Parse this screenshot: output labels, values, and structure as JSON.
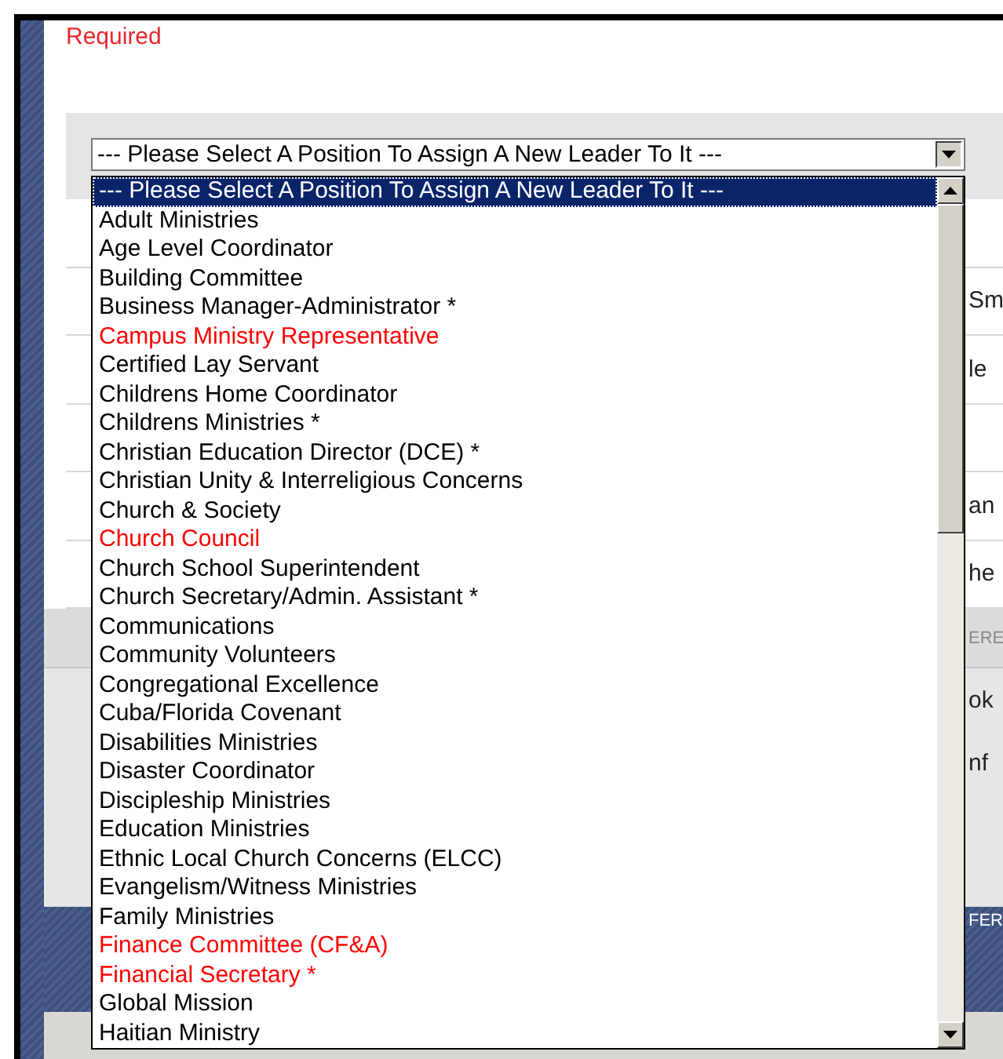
{
  "required_label": "Required",
  "background_table": {
    "rows": [
      {},
      {
        "column_2": "Sm"
      },
      {
        "column_2": "le"
      },
      {},
      {
        "column_2": "an"
      },
      {
        "column_2": "he"
      }
    ]
  },
  "lower_panel": {
    "header": "ERE",
    "rows": [
      {
        "column_2": "ok"
      },
      {
        "column_2": "nf"
      }
    ]
  },
  "footer_band": {
    "text": "FER"
  },
  "position_select": {
    "value": "--- Please Select A Position To Assign A New Leader To It ---",
    "expanded": true,
    "options": [
      {
        "label": "--- Please Select A Position To Assign A New Leader To It ---",
        "selected": true
      },
      {
        "label": "Adult Ministries",
        "selected": false,
        "color": "#000000"
      },
      {
        "label": "Age Level Coordinator",
        "selected": false,
        "color": "#000000"
      },
      {
        "label": "Building Committee",
        "selected": false,
        "color": "#000000"
      },
      {
        "label": "Business Manager-Administrator *",
        "selected": false,
        "color": "#000000"
      },
      {
        "label": "Campus Ministry Representative",
        "selected": false,
        "color": "#ff0000"
      },
      {
        "label": "Certified Lay Servant",
        "selected": false,
        "color": "#000000"
      },
      {
        "label": "Childrens Home Coordinator",
        "selected": false,
        "color": "#000000"
      },
      {
        "label": "Childrens Ministries *",
        "selected": false,
        "color": "#000000"
      },
      {
        "label": "Christian Education Director (DCE) *",
        "selected": false,
        "color": "#000000"
      },
      {
        "label": "Christian Unity & Interreligious Concerns",
        "selected": false,
        "color": "#000000"
      },
      {
        "label": "Church & Society",
        "selected": false,
        "color": "#000000"
      },
      {
        "label": "Church Council",
        "selected": false,
        "color": "#ff0000"
      },
      {
        "label": "Church School Superintendent",
        "selected": false,
        "color": "#000000"
      },
      {
        "label": "Church Secretary/Admin. Assistant *",
        "selected": false,
        "color": "#000000"
      },
      {
        "label": "Communications",
        "selected": false,
        "color": "#000000"
      },
      {
        "label": "Community Volunteers",
        "selected": false,
        "color": "#000000"
      },
      {
        "label": "Congregational Excellence",
        "selected": false,
        "color": "#000000"
      },
      {
        "label": "Cuba/Florida Covenant",
        "selected": false,
        "color": "#000000"
      },
      {
        "label": "Disabilities Ministries",
        "selected": false,
        "color": "#000000"
      },
      {
        "label": "Disaster Coordinator",
        "selected": false,
        "color": "#000000"
      },
      {
        "label": "Discipleship Ministries",
        "selected": false,
        "color": "#000000"
      },
      {
        "label": "Education Ministries",
        "selected": false,
        "color": "#000000"
      },
      {
        "label": "Ethnic Local Church Concerns (ELCC)",
        "selected": false,
        "color": "#000000"
      },
      {
        "label": "Evangelism/Witness Ministries",
        "selected": false,
        "color": "#000000"
      },
      {
        "label": "Family Ministries",
        "selected": false,
        "color": "#000000"
      },
      {
        "label": "Finance Committee (CF&A)",
        "selected": false,
        "color": "#ff0000"
      },
      {
        "label": "Financial Secretary *",
        "selected": false,
        "color": "#ff0000"
      },
      {
        "label": "Global Mission",
        "selected": false,
        "color": "#000000"
      },
      {
        "label": "Haitian Ministry",
        "selected": false,
        "color": "#000000"
      }
    ]
  }
}
